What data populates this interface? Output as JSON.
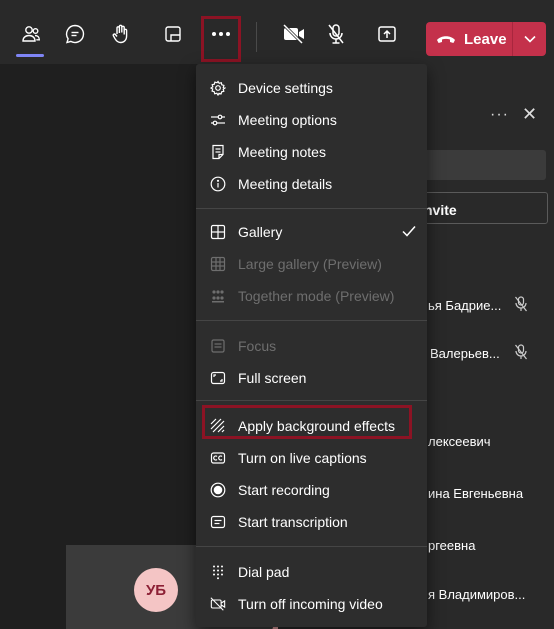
{
  "toolbar": {
    "items": [
      {
        "name": "people-icon"
      },
      {
        "name": "chat-icon"
      },
      {
        "name": "raise-hand-icon"
      },
      {
        "name": "rooms-icon"
      },
      {
        "name": "more-icon"
      },
      {
        "name": "camera-off-icon"
      },
      {
        "name": "mic-off-icon"
      },
      {
        "name": "share-icon"
      }
    ],
    "leave_label": "Leave"
  },
  "menu": {
    "sections": [
      {
        "items": [
          {
            "icon": "gear-icon",
            "label": "Device settings",
            "disabled": false
          },
          {
            "icon": "sliders-icon",
            "label": "Meeting options",
            "disabled": false
          },
          {
            "icon": "notes-icon",
            "label": "Meeting notes",
            "disabled": false
          },
          {
            "icon": "info-icon",
            "label": "Meeting details",
            "disabled": false
          }
        ]
      },
      {
        "items": [
          {
            "icon": "gallery-icon",
            "label": "Gallery",
            "disabled": false,
            "checked": true
          },
          {
            "icon": "large-gallery-icon",
            "label": "Large gallery (Preview)",
            "disabled": true
          },
          {
            "icon": "together-mode-icon",
            "label": "Together mode (Preview)",
            "disabled": true
          }
        ]
      },
      {
        "items": [
          {
            "icon": "focus-icon",
            "label": "Focus",
            "disabled": true
          },
          {
            "icon": "fullscreen-icon",
            "label": "Full screen",
            "disabled": false
          }
        ]
      },
      {
        "items": [
          {
            "icon": "background-effects-icon",
            "label": "Apply background effects",
            "disabled": false,
            "highlighted": true
          },
          {
            "icon": "captions-icon",
            "label": "Turn on live captions",
            "disabled": false
          },
          {
            "icon": "record-icon",
            "label": "Start recording",
            "disabled": false
          },
          {
            "icon": "transcription-icon",
            "label": "Start transcription",
            "disabled": false
          }
        ]
      },
      {
        "items": [
          {
            "icon": "dial-pad-icon",
            "label": "Dial pad",
            "disabled": false
          },
          {
            "icon": "video-off-icon",
            "label": "Turn off incoming video",
            "disabled": false
          }
        ]
      }
    ]
  },
  "panel": {
    "more_glyph": "···",
    "close_glyph": "✕",
    "invite_label": "nvite",
    "participants": [
      {
        "name": "ья Бадрие...",
        "muted": true
      },
      {
        "name": "Валерьев...",
        "muted": true
      },
      {
        "name": "лексеевич",
        "muted": false
      },
      {
        "name": "ина Евгеньевна",
        "muted": false
      },
      {
        "name": "ргеевна",
        "muted": false
      },
      {
        "name": "я Владимиров...",
        "muted": false
      }
    ]
  },
  "stage": {
    "avatar_initials": "УБ"
  },
  "colors": {
    "toolbar_bg": "#292929",
    "menu_bg": "#2d2d2d",
    "leave_red": "#c4314b",
    "highlight_red": "#8c1324",
    "accent": "#7f85f5"
  }
}
